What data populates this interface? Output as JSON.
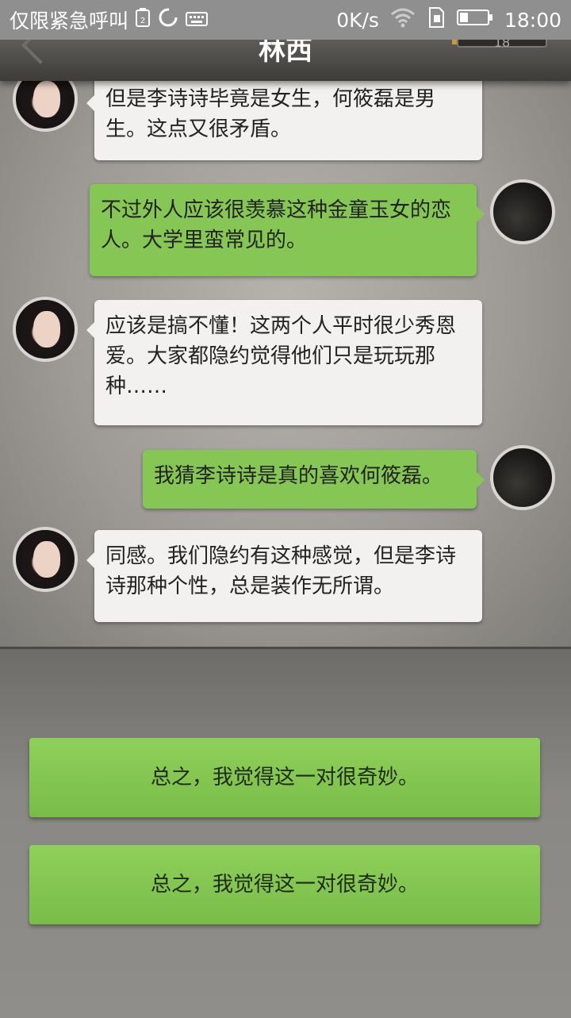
{
  "status_bar": {
    "carrier_text": "仅限紧急呼叫",
    "speed": "0K/s",
    "time": "18:00",
    "icons": [
      "sim-icon",
      "sync-icon",
      "keyboard-icon",
      "sim-card-icon",
      "wifi-icon",
      "battery-icon"
    ]
  },
  "header": {
    "title": "林西",
    "counter": "18"
  },
  "messages": [
    {
      "side": "left",
      "avatar": "girl-avatar",
      "text": "但是李诗诗毕竟是女生，何筱磊是男生。这点又很矛盾。"
    },
    {
      "side": "right",
      "avatar": "player-avatar",
      "text": "不过外人应该很羡慕这种金童玉女的恋人。大学里蛮常见的。"
    },
    {
      "side": "left",
      "avatar": "girl-avatar",
      "text": "应该是搞不懂！这两个人平时很少秀恩爱。大家都隐约觉得他们只是玩玩那种……"
    },
    {
      "side": "right",
      "avatar": "player-avatar",
      "text": "我猜李诗诗是真的喜欢何筱磊。"
    },
    {
      "side": "left",
      "avatar": "girl-avatar",
      "text": "同感。我们隐约有这种感觉，但是李诗诗那种个性，总是装作无所谓。"
    }
  ],
  "choices": [
    {
      "label": "总之，我觉得这一对很奇妙。"
    },
    {
      "label": "总之，我觉得这一对很奇妙。"
    }
  ],
  "colors": {
    "player_bubble": "#86c655",
    "npc_bubble": "#f2f1ef",
    "choice_button": "#86c655"
  }
}
